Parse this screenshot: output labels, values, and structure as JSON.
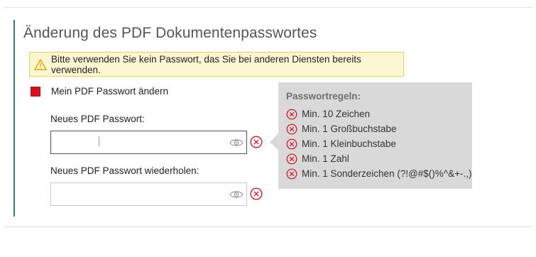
{
  "section": {
    "title": "Änderung des PDF Dokumentenpasswortes"
  },
  "warning": {
    "icon": "warning-triangle-icon",
    "text": "Bitte verwenden Sie kein Passwort, das Sie bei anderen Diensten bereits verwenden."
  },
  "change_password": {
    "checked": true,
    "label": "Mein PDF Passwort ändern"
  },
  "fields": [
    {
      "label": "Neues PDF Passwort:",
      "value": "",
      "placeholder": ""
    },
    {
      "label": "Neues PDF Passwort wiederholen:",
      "value": "",
      "placeholder": ""
    }
  ],
  "rules_tooltip": {
    "title": "Passwortregeln:",
    "rules": [
      {
        "text": "Min. 10 Zeichen",
        "status": "failed"
      },
      {
        "text": "Min. 1 Großbuchstabe",
        "status": "failed"
      },
      {
        "text": "Min. 1 Kleinbuchstabe",
        "status": "failed"
      },
      {
        "text": "Min. 1 Zahl",
        "status": "failed"
      },
      {
        "text": "Min. 1 Sonderzeichen (?!@#$()%^&+-.,)",
        "status": "failed"
      }
    ]
  },
  "colors": {
    "accent": "#2f7d86",
    "checkbox": "#d6121f",
    "error": "#d6121f",
    "warning_bg": "#fdf6d3",
    "warning_border": "#f1cf5a",
    "tooltip_bg": "#d9d9d9"
  }
}
